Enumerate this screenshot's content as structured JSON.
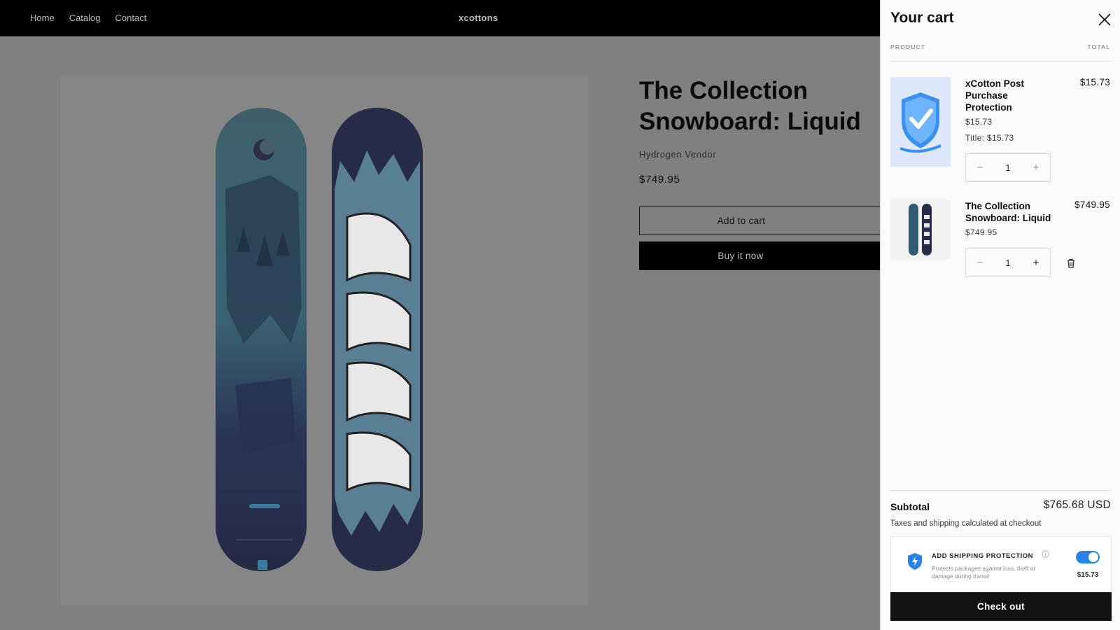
{
  "header": {
    "nav": [
      "Home",
      "Catalog",
      "Contact"
    ],
    "brand": "xcottons"
  },
  "product": {
    "title": "The Collection Snowboard: Liquid",
    "vendor": "Hydrogen Vendor",
    "price": "$749.95",
    "add_to_cart": "Add to cart",
    "buy_now": "Buy it now",
    "image_icon": "snowboard-image"
  },
  "cart": {
    "title": "Your cart",
    "col_product": "PRODUCT",
    "col_total": "TOTAL",
    "items": [
      {
        "name": "xCotton Post Purchase Protection",
        "price": "$15.73",
        "variant": "Title: $15.73",
        "quantity": "1",
        "total": "$15.73",
        "icon": "shield-check-icon"
      },
      {
        "name": "The Collection Snowboard: Liquid",
        "price": "$749.95",
        "quantity": "1",
        "total": "$749.95",
        "icon": "snowboard-thumbnail"
      }
    ],
    "subtotal_label": "Subtotal",
    "subtotal_value": "$765.68 USD",
    "tax_note": "Taxes and shipping calculated at checkout",
    "protection": {
      "title": "ADD SHIPPING PROTECTION",
      "description": "Protects packages against loss, theft or damage during transit",
      "price": "$15.73",
      "enabled": true
    },
    "checkout": "Check out",
    "accent_color": "#2a82e4"
  }
}
